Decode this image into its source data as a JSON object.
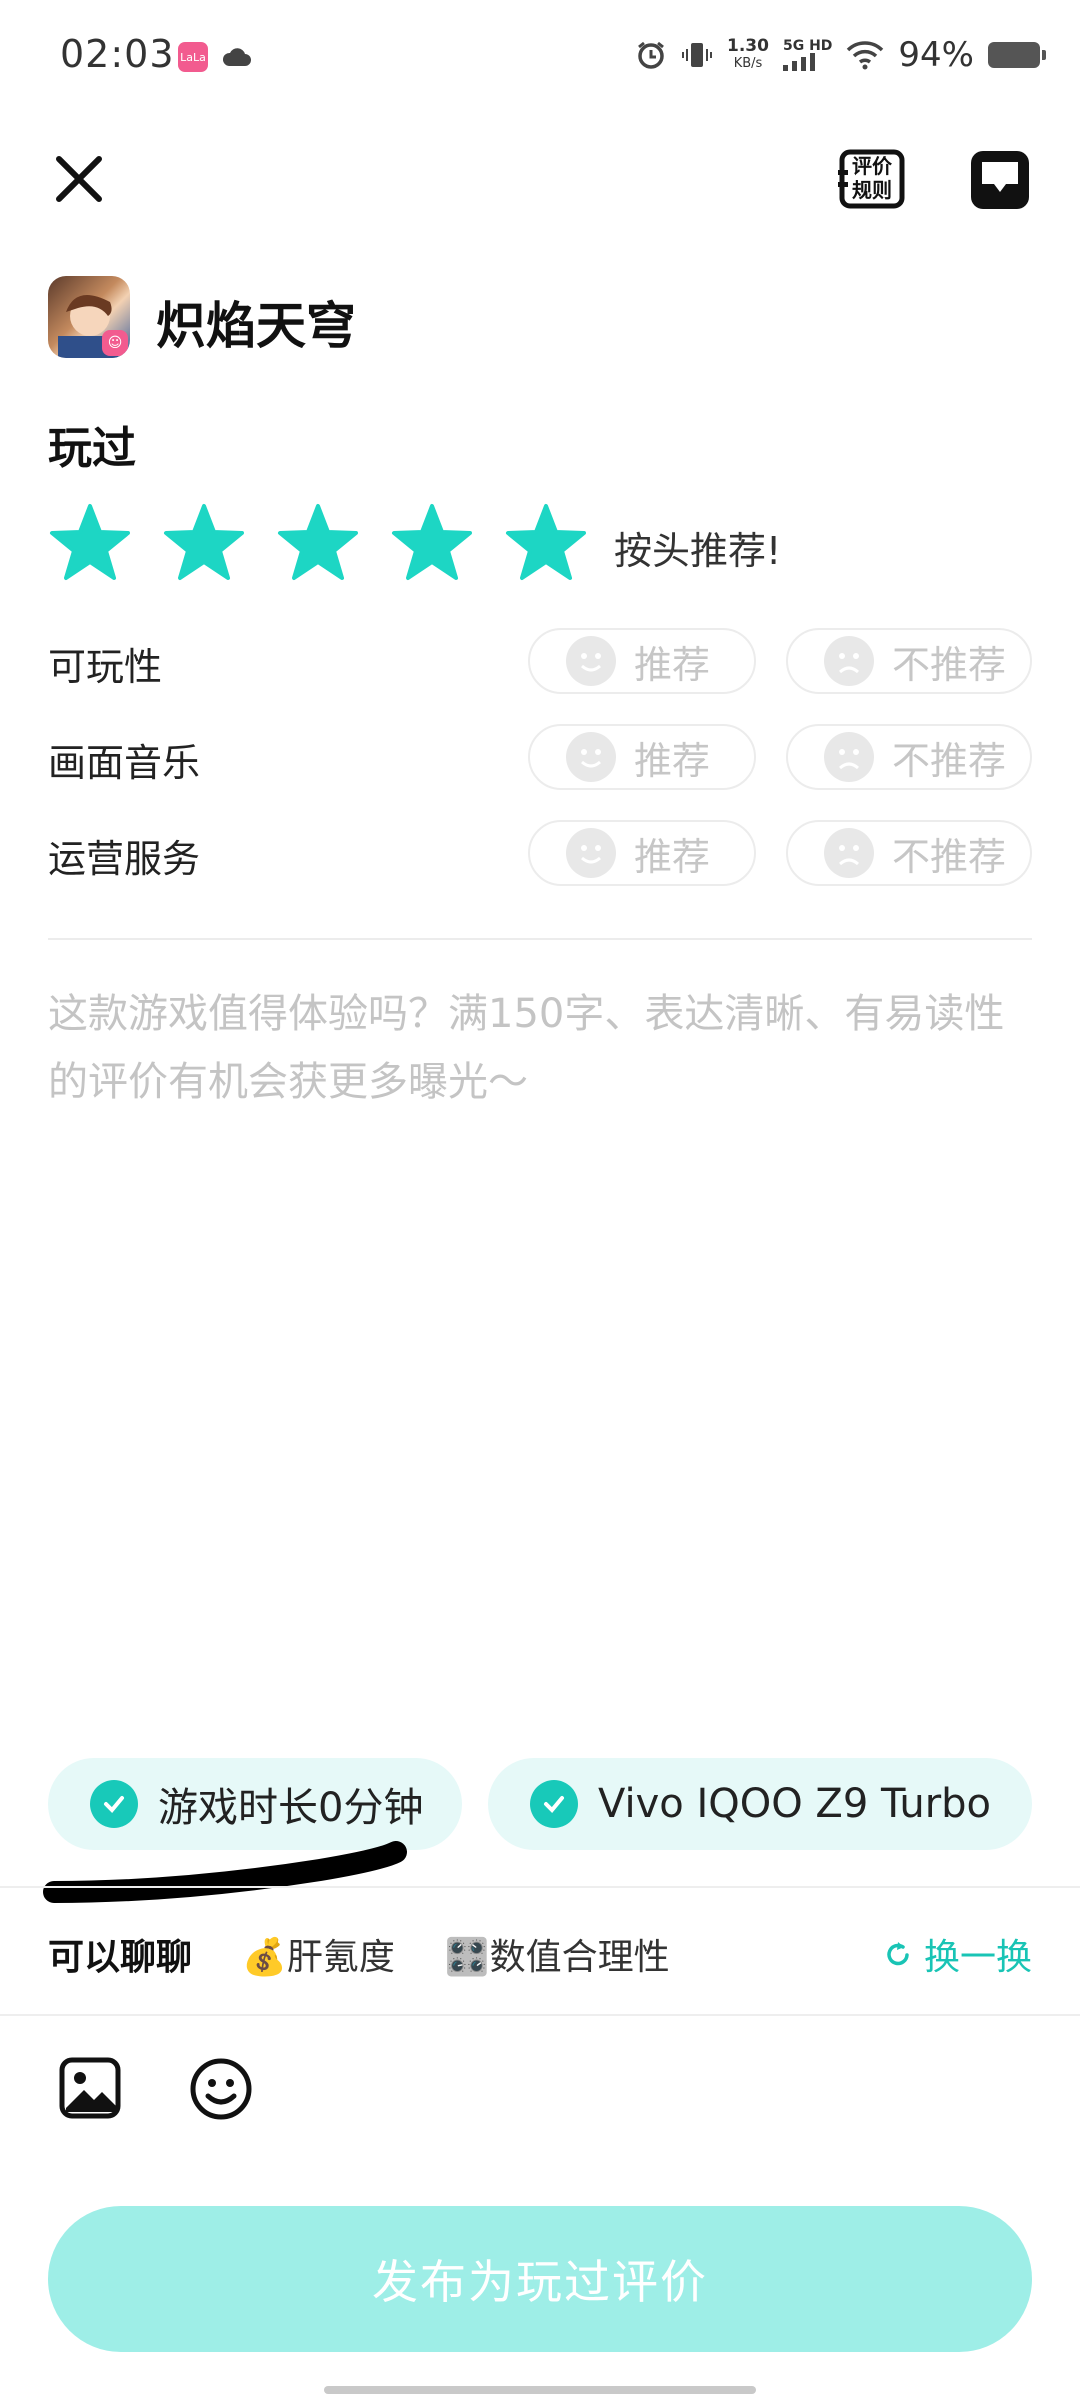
{
  "status_bar": {
    "time": "02:03",
    "speed_value": "1.30",
    "speed_unit": "KB/s",
    "network": "5G HD",
    "battery": "94%",
    "app_badge": "LaLa"
  },
  "header": {
    "rules_label_1": "评价",
    "rules_label_2": "规则"
  },
  "game": {
    "name": "炽焰天穹"
  },
  "status_label": "玩过",
  "rating": {
    "stars": 5,
    "max_stars": 5,
    "text": "按头推荐!"
  },
  "dimensions": [
    {
      "label": "可玩性",
      "recommend": "推荐",
      "not_recommend": "不推荐"
    },
    {
      "label": "画面音乐",
      "recommend": "推荐",
      "not_recommend": "不推荐"
    },
    {
      "label": "运营服务",
      "recommend": "推荐",
      "not_recommend": "不推荐"
    }
  ],
  "review": {
    "placeholder": "这款游戏值得体验吗？满150字、表达清晰、有易读性的评价有机会获更多曝光～"
  },
  "tags": [
    {
      "label": "游戏时长0分钟"
    },
    {
      "label": "Vivo IQOO Z9 Turbo"
    }
  ],
  "topics": [
    {
      "label": "可以聊聊"
    },
    {
      "label": "💰肝氪度"
    },
    {
      "label": "🎛️数值合理性"
    }
  ],
  "switch_label": "换一换",
  "publish_label": "发布为玩过评价",
  "colors": {
    "accent": "#19c4b5",
    "star": "#1dd6c4",
    "publish_bg": "#9eeee7"
  }
}
